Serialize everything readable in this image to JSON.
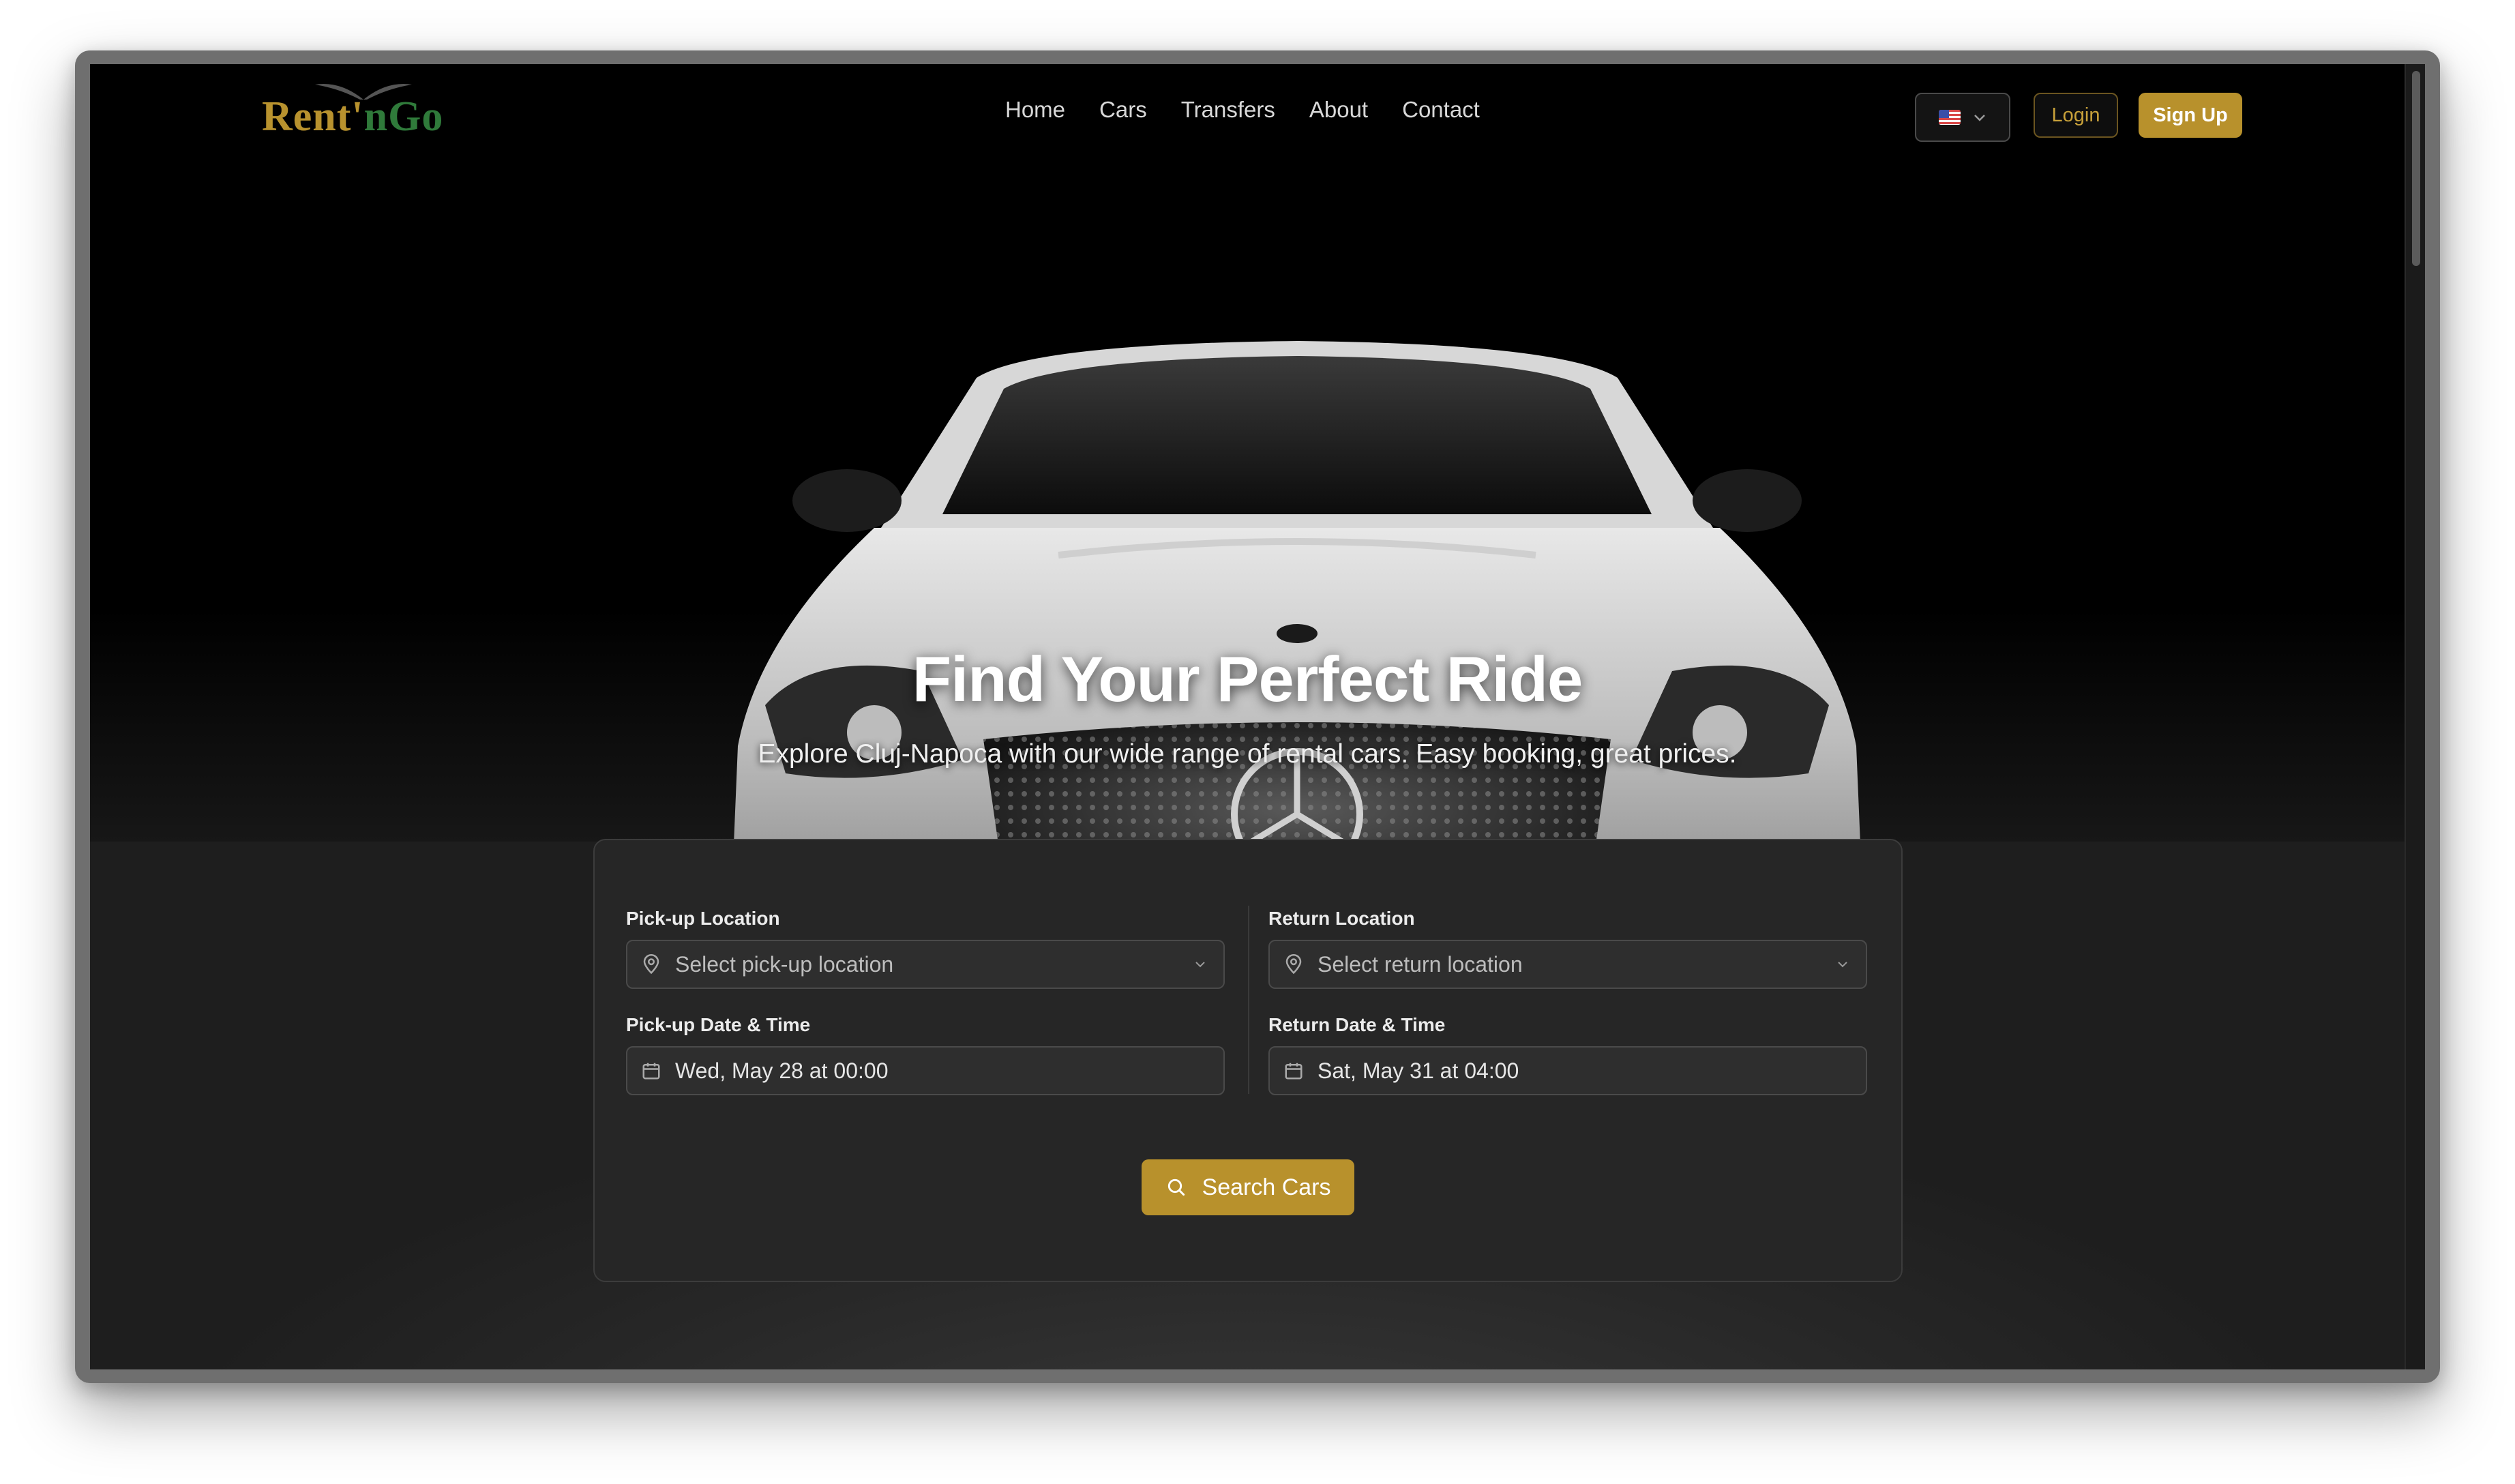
{
  "brand": {
    "logo_part1": "Rent'",
    "logo_part2": "nGo"
  },
  "nav": {
    "links": [
      "Home",
      "Cars",
      "Transfers",
      "About",
      "Contact"
    ],
    "language_icon": "us-flag-icon",
    "login_label": "Login",
    "signup_label": "Sign Up"
  },
  "hero": {
    "title": "Find Your Perfect Ride",
    "subtitle": "Explore Cluj-Napoca with our wide range of rental cars. Easy booking, great prices."
  },
  "booking": {
    "pickup_location": {
      "label": "Pick-up Location",
      "placeholder": "Select pick-up location",
      "icon": "map-pin-icon"
    },
    "return_location": {
      "label": "Return Location",
      "placeholder": "Select return location",
      "icon": "map-pin-icon"
    },
    "pickup_datetime": {
      "label": "Pick-up Date & Time",
      "value": "Wed, May 28 at 00:00",
      "icon": "calendar-icon"
    },
    "return_datetime": {
      "label": "Return Date & Time",
      "value": "Sat, May 31 at 04:00",
      "icon": "calendar-icon"
    },
    "search_label": "Search Cars",
    "search_icon": "search-icon"
  },
  "colors": {
    "accent": "#b8912c",
    "background": "#262626",
    "hero_bg": "#000000",
    "logo_gold": "#b8922e",
    "logo_green": "#2f7a3a"
  }
}
